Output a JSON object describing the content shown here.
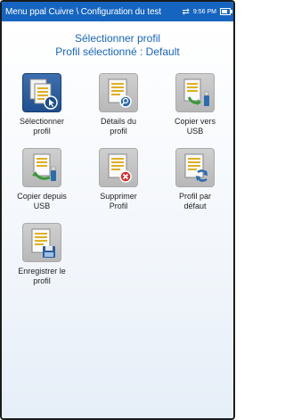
{
  "status_bar": {
    "title": "Menu ppal Cuivre \\ Configuration du test",
    "time": "9:56 PM",
    "sync_icon": "sync-icon",
    "battery_icon": "battery-icon",
    "battery_level": 0.8
  },
  "heading": {
    "line1": "Sélectionner profil",
    "line2": "Profil sélectionné : Default"
  },
  "tiles": [
    {
      "line1": "Sélectionner",
      "line2": "profil",
      "icon": "select-profile-icon",
      "selected": true
    },
    {
      "line1": "Détails du",
      "line2": "profil",
      "icon": "profile-details-icon",
      "selected": false
    },
    {
      "line1": "Copier vers",
      "line2": "USB",
      "icon": "copy-to-usb-icon",
      "selected": false
    },
    {
      "line1": "Copier depuis",
      "line2": "USB",
      "icon": "copy-from-usb-icon",
      "selected": false
    },
    {
      "line1": "Supprimer",
      "line2": "Profil",
      "icon": "delete-profile-icon",
      "selected": false
    },
    {
      "line1": "Profil par",
      "line2": "défaut",
      "icon": "default-profile-icon",
      "selected": false
    },
    {
      "line1": "Enregistrer le",
      "line2": "profil",
      "icon": "save-profile-icon",
      "selected": false
    }
  ],
  "colors": {
    "accent": "#1565c0",
    "tile_bg": "#bcbcbc",
    "selected_tile_bg": "#2a5a9a"
  }
}
